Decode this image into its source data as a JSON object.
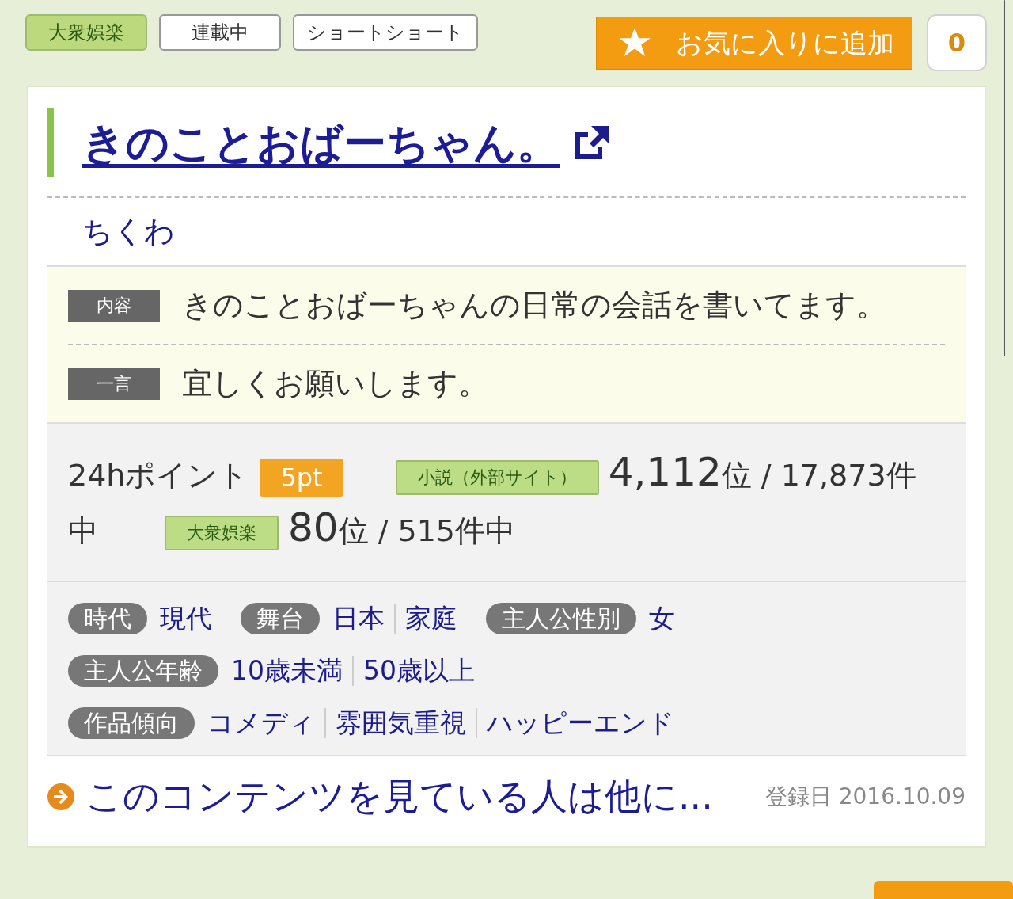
{
  "genre_tags": [
    {
      "label": "大衆娯楽",
      "selected": true
    },
    {
      "label": "連載中",
      "selected": false
    },
    {
      "label": "ショートショート",
      "selected": false
    }
  ],
  "favorite": {
    "label": "お気に入りに追加",
    "count": "0"
  },
  "title": "きのことおばーちゃん。",
  "author": "ちくわ",
  "details": [
    {
      "label": "内容",
      "text": "きのことおばーちゃんの日常の会話を書いてます。"
    },
    {
      "label": "一言",
      "text": "宜しくお願いします。"
    }
  ],
  "ranking": {
    "points_label": "24hポイント",
    "points": "5pt",
    "rows": [
      {
        "category": "小説（外部サイト）",
        "rank": "4,112",
        "rank_unit": "位",
        "total_lines": [
          "/ 17,873件",
          "中"
        ]
      },
      {
        "category": "大衆娯楽",
        "rank": "80",
        "rank_unit": "位",
        "total_lines": [
          "/ 515件中"
        ]
      }
    ]
  },
  "attributes": [
    {
      "label": "時代",
      "values": [
        "現代"
      ]
    },
    {
      "label": "舞台",
      "values": [
        "日本",
        "家庭"
      ]
    },
    {
      "label": "主人公性別",
      "values": [
        "女"
      ]
    },
    {
      "label": "主人公年齢",
      "values": [
        "10歳未満",
        "50歳以上"
      ]
    },
    {
      "label": "作品傾向",
      "values": [
        "コメディ",
        "雰囲気重視",
        "ハッピーエンド"
      ]
    }
  ],
  "footer": {
    "link": "このコンテンツを見ている人は他に...",
    "date": "登録日 2016.10.09"
  }
}
